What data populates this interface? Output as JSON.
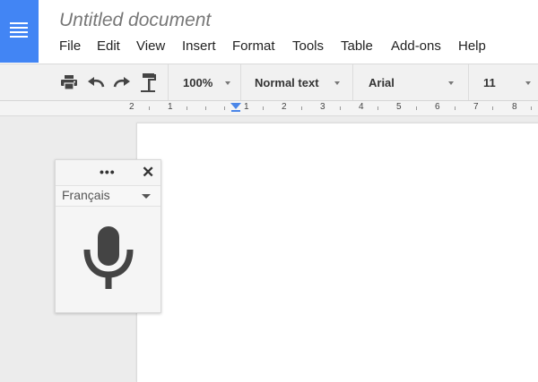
{
  "document": {
    "title": "Untitled document"
  },
  "menu": [
    "File",
    "Edit",
    "View",
    "Insert",
    "Format",
    "Tools",
    "Table",
    "Add-ons",
    "Help"
  ],
  "toolbar": {
    "zoom": "100%",
    "style": "Normal text",
    "font": "Arial",
    "font_size": "11"
  },
  "ruler": {
    "labels": [
      "2",
      "1",
      "1",
      "2",
      "3",
      "4",
      "5",
      "6",
      "7",
      "8"
    ]
  },
  "voice_typing": {
    "more_label": "•••",
    "close_label": "✕",
    "language": "Français"
  },
  "icons": [
    "docs-logo-icon",
    "print-icon",
    "undo-icon",
    "redo-icon",
    "paint-format-icon",
    "close-icon",
    "more-options-icon",
    "microphone-icon",
    "dropdown-caret-icon"
  ],
  "colors": {
    "brand": "#4285f4",
    "ruler_indent": "#4a86e8"
  }
}
